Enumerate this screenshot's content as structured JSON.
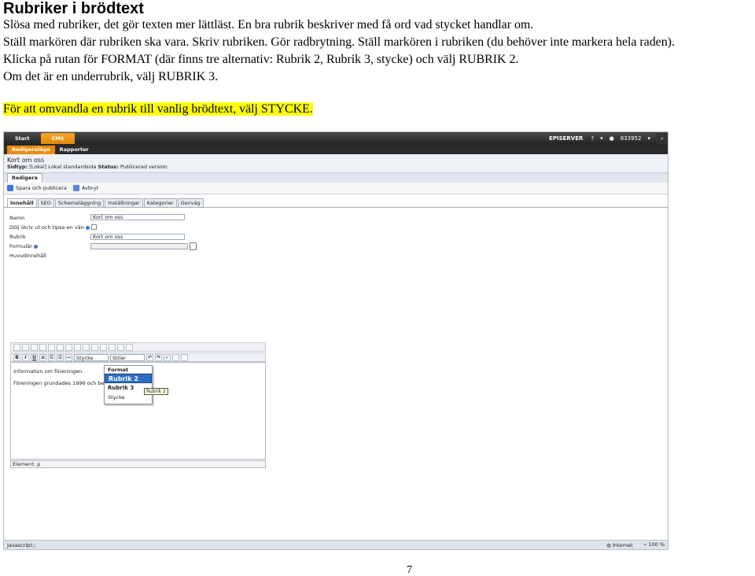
{
  "doc": {
    "title": "Rubriker i brödtext",
    "lines": [
      "Slösa med rubriker, det gör texten mer lättläst. En bra rubrik beskriver med få ord vad stycket handlar om.",
      "Ställ markören där rubriken ska vara. Skriv rubriken. Gör radbrytning. Ställ markören i rubriken (du behöver inte markera hela raden)."
    ],
    "line3": {
      "a": "Klicka på rutan för ",
      "b": "FORMAT",
      "c": " (där finns tre alternativ: Rubrik 2, Rubrik 3, stycke) och välj ",
      "d": "RUBRIK",
      "e": " 2."
    },
    "line4": {
      "a": "Om det är en underrubrik, välj ",
      "b": "RUBRIK",
      "c": " 3."
    },
    "line5": {
      "a": "För att omvandla en rubrik till vanlig brödtext, välj ",
      "b": "STYCKE",
      "c": "."
    },
    "highlight_color": "#ffff00",
    "page_number": "7"
  },
  "screenshot": {
    "topbar": {
      "start": "Start",
      "cms": "CMS",
      "brand": "EPISERVER",
      "help": "?",
      "user": "833952",
      "accent": "#e88b0c"
    },
    "modebar": {
      "active": "Redigeraläge",
      "other": "Rapporter"
    },
    "info": {
      "page_name": "Kort om oss",
      "pagetype_label": "Sidtyp:",
      "pagetype_value": "[Lokal] Lokal standardsida",
      "status_label": "Status:",
      "status_value": "Publicerad version"
    },
    "redigera": "Redigera",
    "actions": {
      "save": "Spara och publicera",
      "cancel": "Avbryt"
    },
    "tabs": [
      "Innehåll",
      "SEO",
      "Schemaläggning",
      "Inställningar",
      "Kategorier",
      "Genväg"
    ],
    "form": {
      "namn_label": "Namn",
      "namn_value": "Kort om oss",
      "dolj_label": "Dölj skriv ut och tipsa en vän",
      "rubrik_label": "Rubrik",
      "rubrik_value": "Kort om oss",
      "formular_label": "Formulär",
      "huvud_label": "Huvudinnehåll"
    },
    "toolbar": {
      "bold": "B",
      "italic": "I",
      "underline": "U",
      "format_value": "Stycke",
      "style_value": "Stilar"
    },
    "editor": {
      "p1": "Information om föreningen",
      "p2": "Föreningen grundades 1996 och best"
    },
    "dropdown": {
      "header": "Format",
      "items": [
        "Rubrik 2",
        "Rubrik 3",
        "Stycke"
      ]
    },
    "tooltip": "Rubrik 2",
    "element": "Element: p",
    "status": {
      "left": "Javascript:;",
      "zone": "Internet",
      "zoom": "100 %"
    }
  }
}
